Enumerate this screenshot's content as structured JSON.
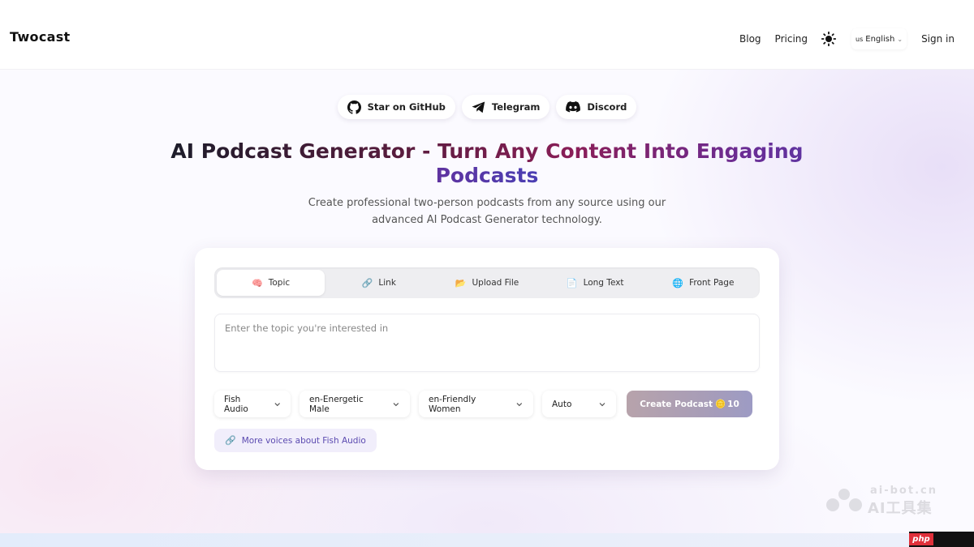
{
  "header": {
    "logo": "Twocast",
    "nav": [
      "Blog",
      "Pricing"
    ],
    "theme_icon": "sun-icon",
    "language": {
      "flag": "us",
      "label": "English"
    },
    "sign_in": "Sign in"
  },
  "social": [
    {
      "label": "Star on GitHub",
      "icon": "github-icon"
    },
    {
      "label": "Telegram",
      "icon": "telegram-icon"
    },
    {
      "label": "Discord",
      "icon": "discord-icon"
    }
  ],
  "hero": {
    "title": "AI Podcast Generator - Turn Any Content Into Engaging Podcasts",
    "subtitle": "Create professional two-person podcasts from any source using our advanced AI Podcast Generator technology."
  },
  "tabs": [
    {
      "label": "Topic",
      "icon": "🧠",
      "active": true
    },
    {
      "label": "Link",
      "icon": "🔗",
      "active": false
    },
    {
      "label": "Upload File",
      "icon": "📂",
      "active": false
    },
    {
      "label": "Long Text",
      "icon": "📄",
      "active": false
    },
    {
      "label": "Front Page",
      "icon": "🌐",
      "active": false
    }
  ],
  "topic_input": {
    "placeholder": "Enter the topic you're interested in",
    "value": ""
  },
  "selects": {
    "provider": "Fish Audio",
    "voice_1": "en-Energetic Male",
    "voice_2": "en-Friendly Women",
    "language": "Auto"
  },
  "create_button": {
    "label": "Create Podcast",
    "coin_icon": "🪙",
    "cost": "10"
  },
  "more_voices": {
    "icon": "🔗",
    "label": "More voices about Fish Audio"
  },
  "watermark": {
    "top": "ai-bot.cn",
    "bottom": "AI工具集",
    "badge": "php"
  },
  "colors": {
    "create_button_start": "#b7a3ab",
    "create_button_end": "#9d9bc4",
    "more_voices_text": "#5b4ab0"
  }
}
